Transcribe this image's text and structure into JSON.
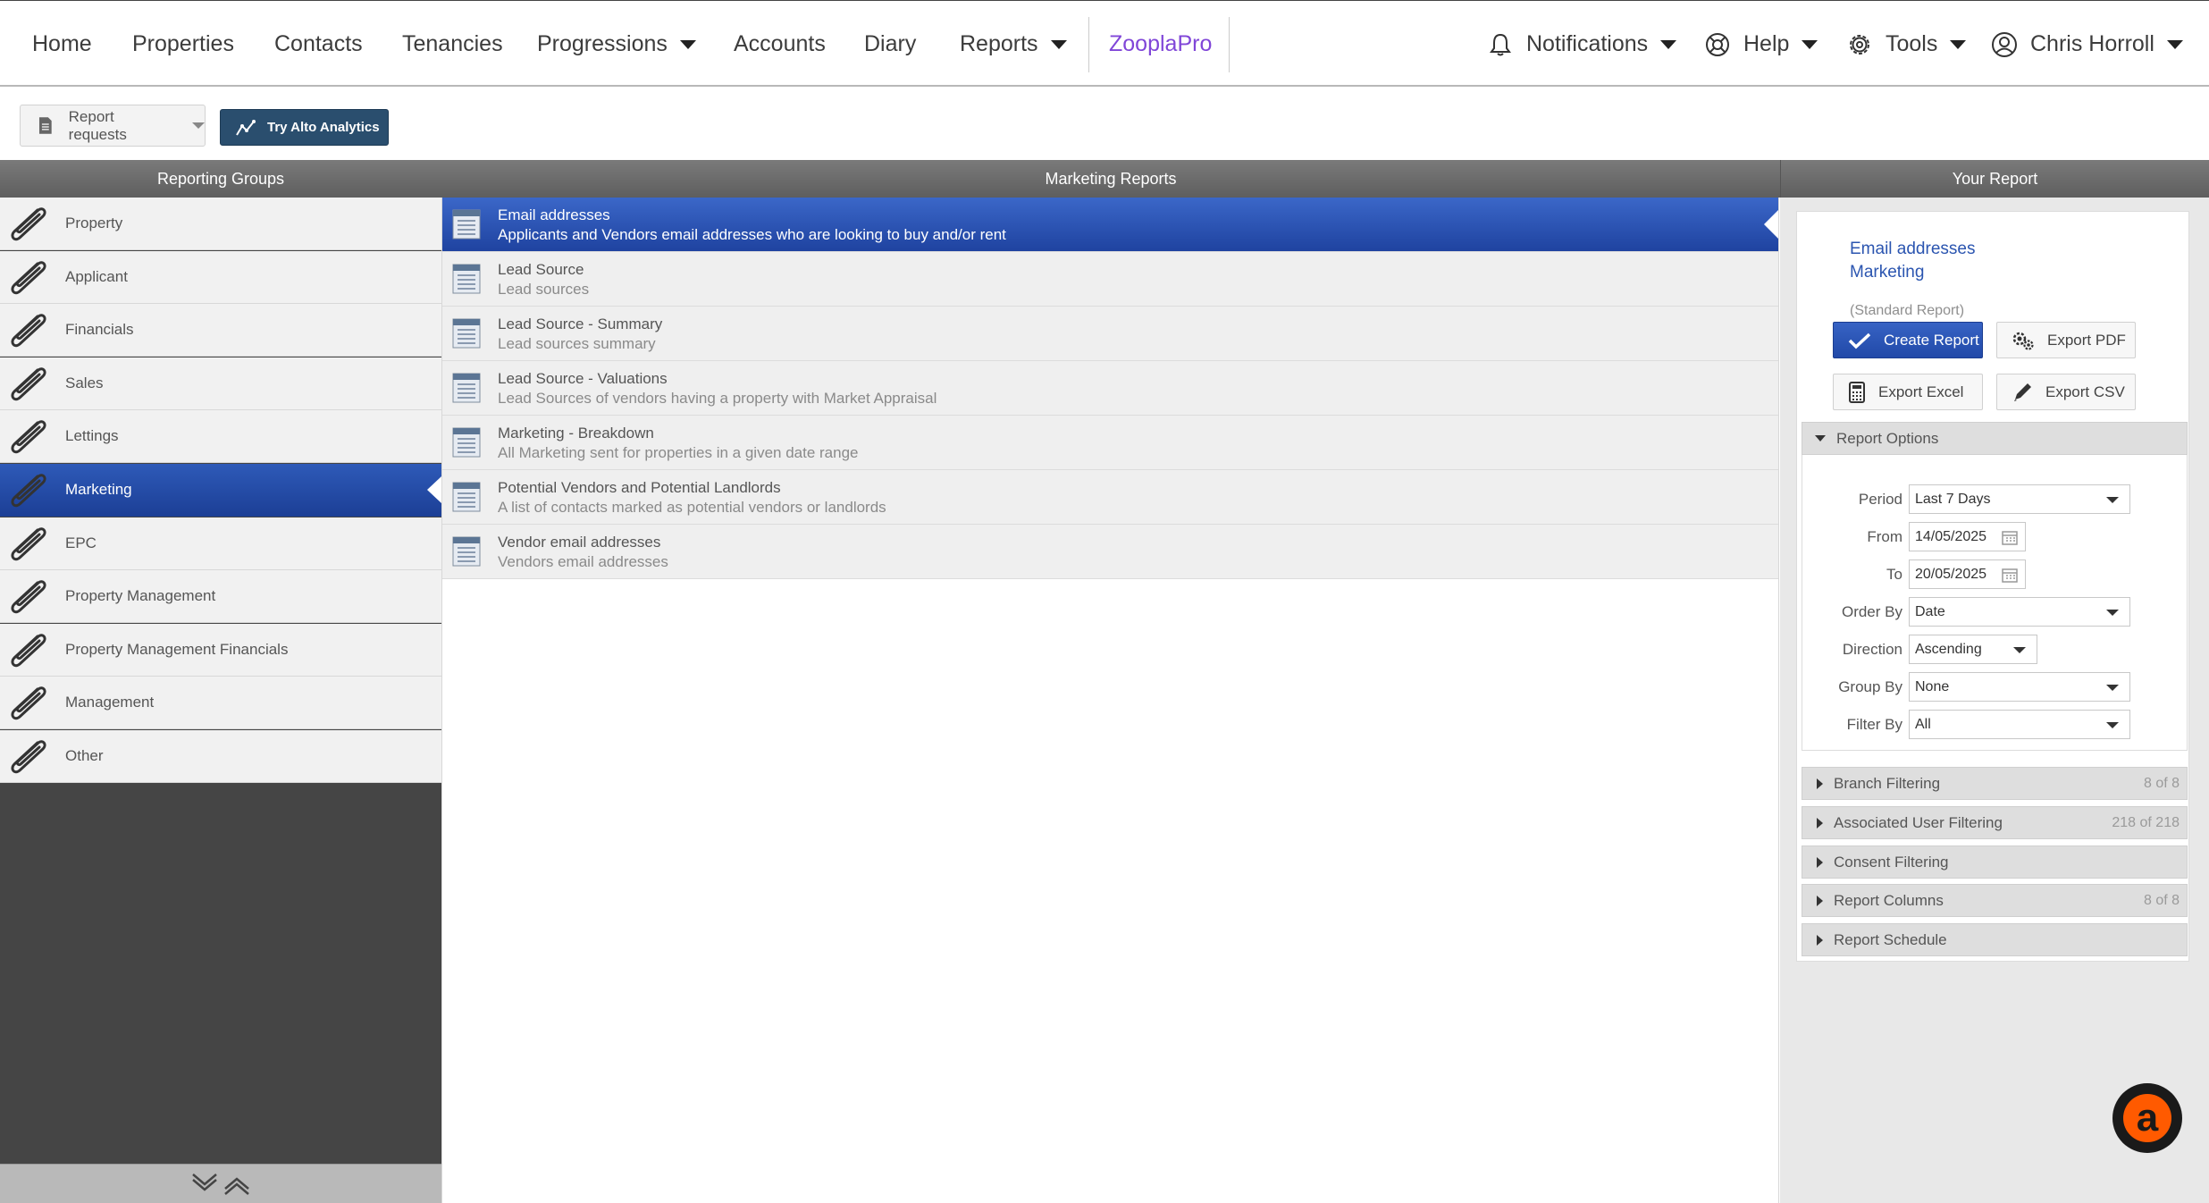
{
  "nav": {
    "home": "Home",
    "properties": "Properties",
    "contacts": "Contacts",
    "tenancies": "Tenancies",
    "progressions": "Progressions",
    "accounts": "Accounts",
    "diary": "Diary",
    "reports": "Reports",
    "zooplapro": "ZooplaPro",
    "notifications": "Notifications",
    "help": "Help",
    "tools": "Tools",
    "user": "Chris Horroll",
    "brand_color": "#8046d8"
  },
  "toolbar": {
    "report_requests": "Report requests",
    "try_analytics": "Try Alto Analytics"
  },
  "left": {
    "header": "Reporting Groups",
    "items": [
      {
        "label": "Property"
      },
      {
        "label": "Applicant"
      },
      {
        "label": "Financials"
      },
      {
        "label": "Sales"
      },
      {
        "label": "Lettings"
      },
      {
        "label": "Marketing"
      },
      {
        "label": "EPC"
      },
      {
        "label": "Property Management"
      },
      {
        "label": "Property Management Financials"
      },
      {
        "label": "Management"
      },
      {
        "label": "Other"
      }
    ],
    "active": "Marketing"
  },
  "middle": {
    "header": "Marketing Reports",
    "reports": [
      {
        "title": "Email addresses",
        "desc": "Applicants and Vendors email addresses who are looking to buy and/or rent"
      },
      {
        "title": "Lead Source",
        "desc": "Lead sources"
      },
      {
        "title": "Lead Source - Summary",
        "desc": "Lead sources summary"
      },
      {
        "title": "Lead Source - Valuations",
        "desc": "Lead Sources of vendors having a property with Market Appraisal"
      },
      {
        "title": "Marketing - Breakdown",
        "desc": "All Marketing sent for properties in a given date range"
      },
      {
        "title": "Potential Vendors and Potential Landlords",
        "desc": "A list of contacts marked as potential vendors or landlords"
      },
      {
        "title": "Vendor email addresses",
        "desc": "Vendors email addresses"
      }
    ]
  },
  "right": {
    "header": "Your Report",
    "report_name": "Email addresses",
    "report_group": "Marketing",
    "report_type": "(Standard Report)",
    "create_report": "Create Report",
    "export_pdf": "Export PDF",
    "export_excel": "Export Excel",
    "export_csv": "Export CSV",
    "options_title": "Report Options",
    "options": {
      "period_label": "Period",
      "period_value": "Last 7 Days",
      "from_label": "From",
      "from_value": "14/05/2025",
      "to_label": "To",
      "to_value": "20/05/2025",
      "order_by_label": "Order By",
      "order_by_value": "Date",
      "direction_label": "Direction",
      "direction_value": "Ascending",
      "group_by_label": "Group By",
      "group_by_value": "None",
      "filter_by_label": "Filter By",
      "filter_by_value": "All"
    },
    "sections": [
      {
        "label": "Branch Filtering",
        "count": "8 of 8"
      },
      {
        "label": "Associated User Filtering",
        "count": "218 of 218"
      },
      {
        "label": "Consent Filtering",
        "count": ""
      },
      {
        "label": "Report Columns",
        "count": "8 of 8"
      },
      {
        "label": "Report Schedule",
        "count": ""
      }
    ]
  },
  "fab": {
    "letter": "a",
    "color": "#ff5a00"
  }
}
